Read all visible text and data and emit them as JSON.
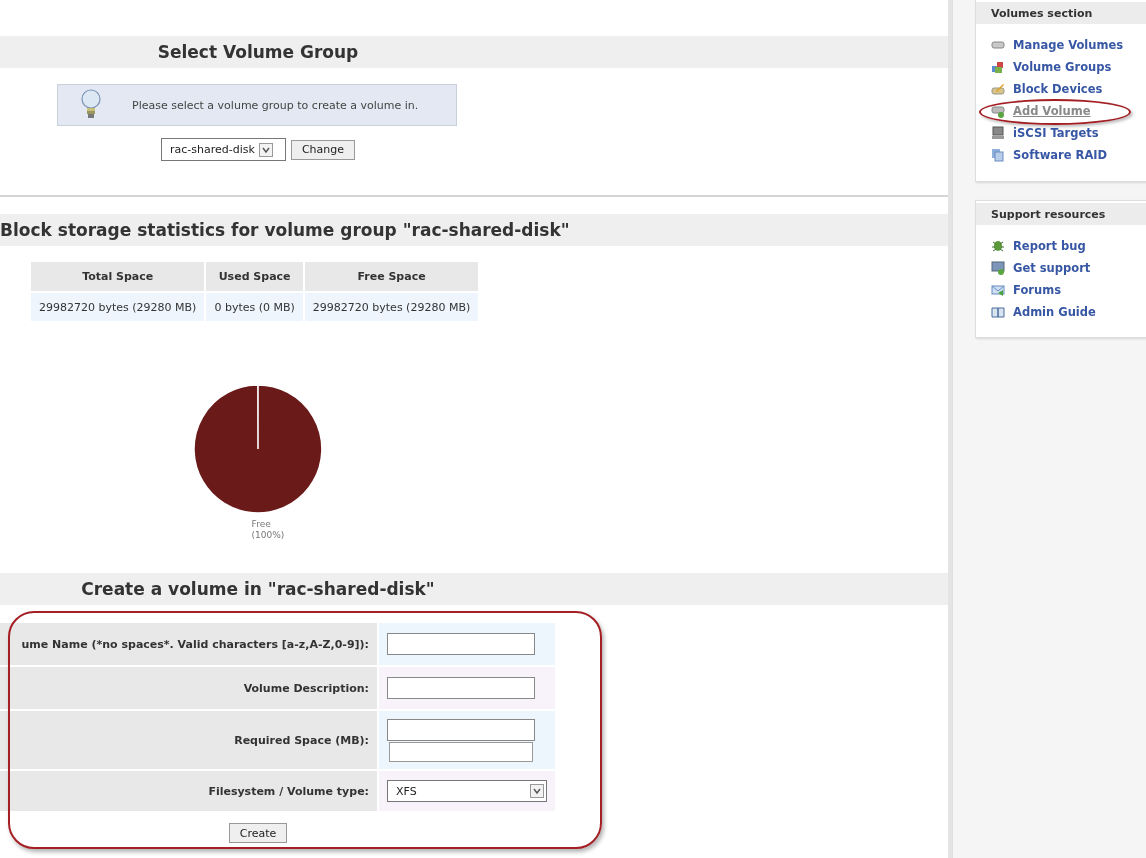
{
  "main": {
    "select_group": {
      "title": "Select Volume Group",
      "info": "Please select a volume group to create a volume in.",
      "group_select": {
        "value": "rac-shared-disk"
      },
      "change_button": "Change"
    },
    "statistics": {
      "title": "Block storage statistics for volume group \"rac-shared-disk\"",
      "columns": [
        "Total Space",
        "Used Space",
        "Free Space"
      ],
      "rows": [
        [
          "29982720 bytes (29280 MB)",
          "0 bytes (0 MB)",
          "29982720 bytes (29280 MB)"
        ]
      ],
      "chart_data": {
        "type": "pie",
        "categories": [
          "Free"
        ],
        "values": [
          100
        ],
        "value_labels": [
          "(100%)"
        ]
      }
    },
    "create_volume": {
      "title": "Create a volume in \"rac-shared-disk\"",
      "circled": true,
      "fields": [
        {
          "kind": "text",
          "label": "ume Name (*no spaces*. Valid characters [a-z,A-Z,0-9]):"
        },
        {
          "kind": "text",
          "label": "Volume Description:"
        },
        {
          "kind": "double",
          "label": "Required Space (MB):"
        },
        {
          "kind": "select",
          "label": "Filesystem / Volume type:",
          "value": "XFS"
        }
      ],
      "create_button": "Create"
    }
  },
  "sidebar": {
    "sections": [
      {
        "title": "Volumes section",
        "items": [
          {
            "label": "Manage Volumes",
            "selected": false,
            "circled": false
          },
          {
            "label": "Volume Groups",
            "selected": false,
            "circled": false
          },
          {
            "label": "Block Devices",
            "selected": false,
            "circled": false
          },
          {
            "label": "Add Volume",
            "selected": true,
            "circled": true
          },
          {
            "label": "iSCSI Targets",
            "selected": false,
            "circled": false
          },
          {
            "label": "Software RAID",
            "selected": false,
            "circled": false
          }
        ]
      },
      {
        "title": "Support resources",
        "items": [
          {
            "label": "Report bug",
            "selected": false,
            "circled": false
          },
          {
            "label": "Get support",
            "selected": false,
            "circled": false
          },
          {
            "label": "Forums",
            "selected": false,
            "circled": false
          },
          {
            "label": "Admin Guide",
            "selected": false,
            "circled": false
          }
        ]
      }
    ]
  }
}
